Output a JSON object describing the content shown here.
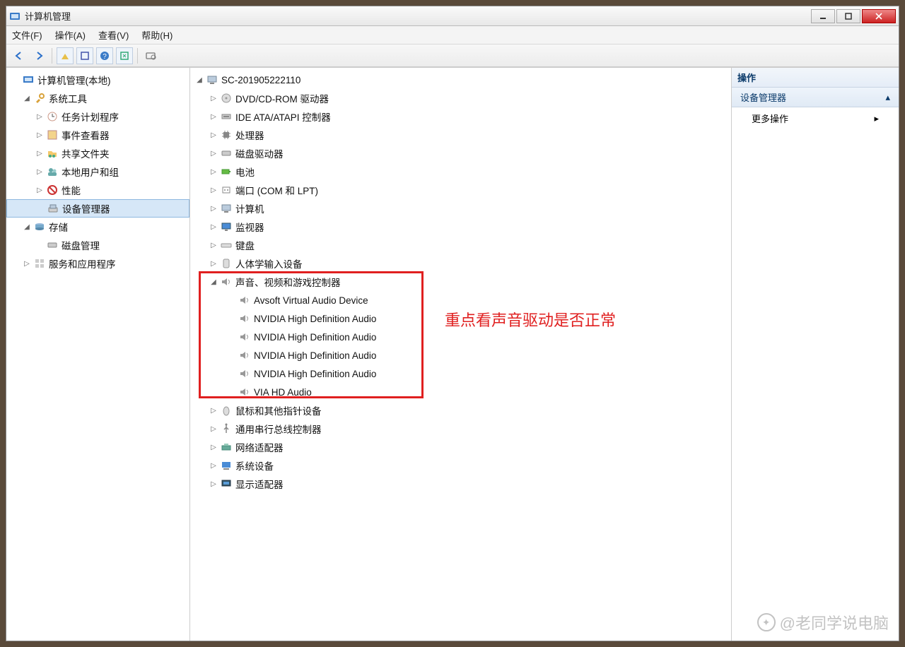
{
  "window": {
    "title": "计算机管理"
  },
  "menu": {
    "file": "文件(F)",
    "action": "操作(A)",
    "view": "查看(V)",
    "help": "帮助(H)"
  },
  "left_tree": {
    "root": "计算机管理(本地)",
    "system_tools": "系统工具",
    "task_scheduler": "任务计划程序",
    "event_viewer": "事件查看器",
    "shared_folders": "共享文件夹",
    "local_users": "本地用户和组",
    "performance": "性能",
    "device_manager": "设备管理器",
    "storage": "存储",
    "disk_mgmt": "磁盘管理",
    "services_apps": "服务和应用程序"
  },
  "devices": {
    "root": "SC-201905222110",
    "dvd": "DVD/CD-ROM 驱动器",
    "ide": "IDE ATA/ATAPI 控制器",
    "cpu": "处理器",
    "disk_drive": "磁盘驱动器",
    "battery": "电池",
    "ports": "端口 (COM 和 LPT)",
    "computer": "计算机",
    "monitor": "监视器",
    "keyboard": "键盘",
    "hid": "人体学输入设备",
    "sound": "声音、视频和游戏控制器",
    "sound_children": [
      "Avsoft Virtual Audio Device",
      "NVIDIA High Definition Audio",
      "NVIDIA High Definition Audio",
      "NVIDIA High Definition Audio",
      "NVIDIA High Definition Audio",
      "VIA HD Audio"
    ],
    "mouse": "鼠标和其他指针设备",
    "usb": "通用串行总线控制器",
    "net": "网络适配器",
    "system": "系统设备",
    "display": "显示适配器"
  },
  "annotation": "重点看声音驱动是否正常",
  "actions": {
    "header": "操作",
    "section": "设备管理器",
    "more": "更多操作"
  },
  "watermark": "@老同学说电脑"
}
